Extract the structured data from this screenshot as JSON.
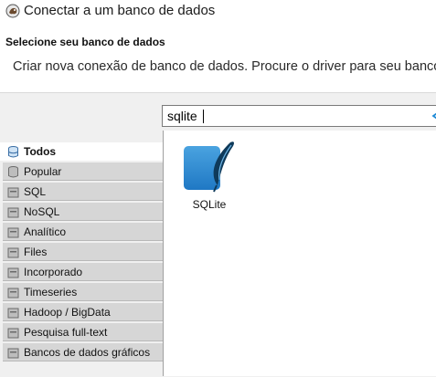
{
  "window": {
    "title": "Conectar a um banco de dados",
    "icon": "dbeaver-icon"
  },
  "header": {
    "heading": "Selecione seu banco de dados",
    "description": "Criar nova conexão de banco de dados. Procure o driver para seu banco"
  },
  "search": {
    "value": "sqlite",
    "clear_icon": "clear-icon"
  },
  "categories": [
    {
      "label": "Todos",
      "selected": true
    },
    {
      "label": "Popular",
      "selected": false
    },
    {
      "label": "SQL",
      "selected": false
    },
    {
      "label": "NoSQL",
      "selected": false
    },
    {
      "label": "Analítico",
      "selected": false
    },
    {
      "label": "Files",
      "selected": false
    },
    {
      "label": "Incorporado",
      "selected": false
    },
    {
      "label": "Timeseries",
      "selected": false
    },
    {
      "label": "Hadoop / BigData",
      "selected": false
    },
    {
      "label": "Pesquisa full-text",
      "selected": false
    },
    {
      "label": "Bancos de dados gráficos",
      "selected": false
    }
  ],
  "drivers": [
    {
      "label": "SQLite",
      "icon": "sqlite-icon"
    }
  ],
  "colors": {
    "accent_blue": "#1f8ad6",
    "sidebar_gray": "#d6d6d6",
    "panel_gray": "#f0f0f0"
  }
}
